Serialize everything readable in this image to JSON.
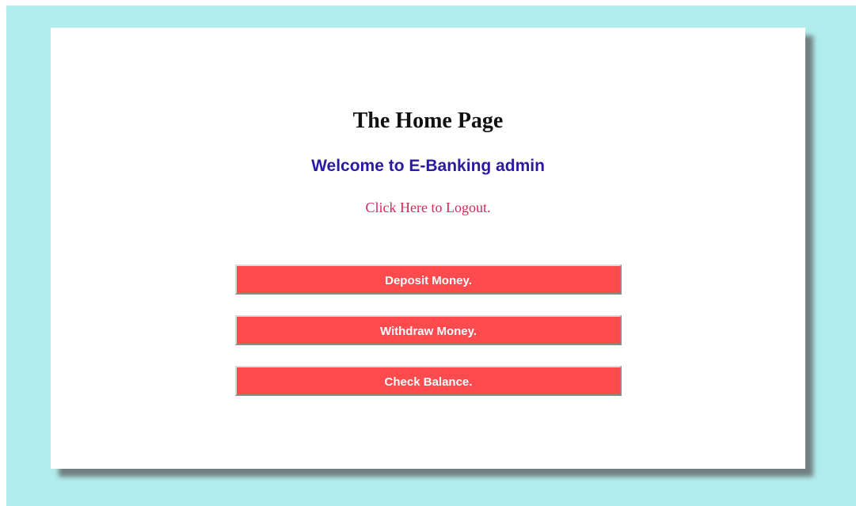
{
  "page": {
    "title": "The Home Page",
    "welcome": "Welcome to E-Banking admin",
    "logout_link": "Click Here to Logout."
  },
  "actions": [
    {
      "label": "Deposit Money."
    },
    {
      "label": "Withdraw Money."
    },
    {
      "label": "Check Balance."
    }
  ],
  "colors": {
    "background": "#b2eded",
    "card": "#ffffff",
    "button": "#ff4a4e",
    "welcome_text": "#2b1aa0",
    "logout_text": "#d8275a"
  }
}
